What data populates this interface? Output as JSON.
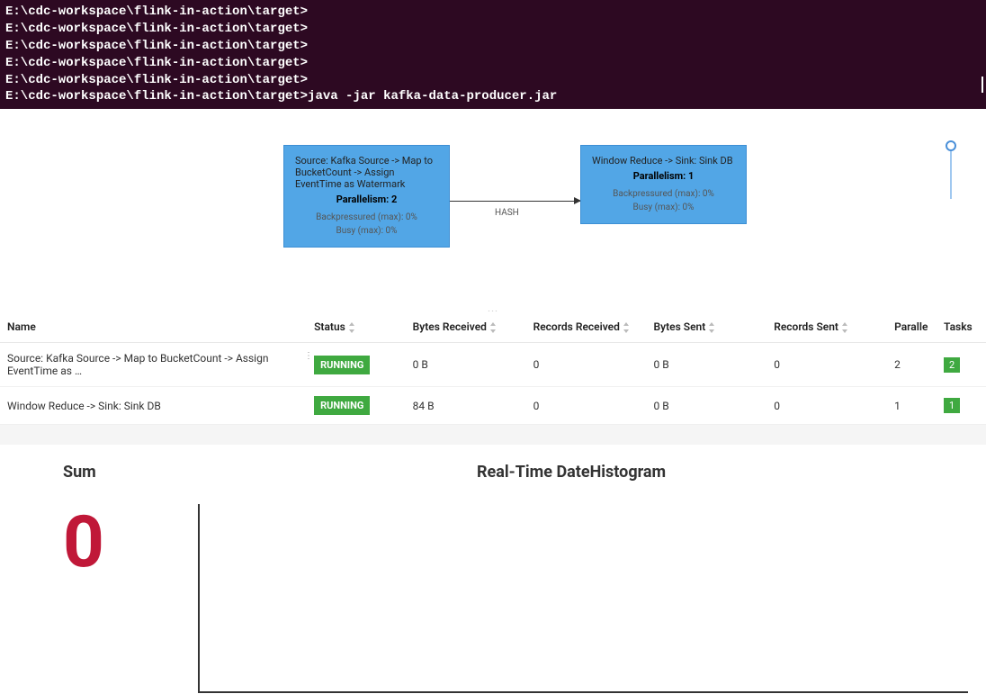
{
  "terminal": {
    "lines": [
      "E:\\cdc-workspace\\flink-in-action\\target>",
      "E:\\cdc-workspace\\flink-in-action\\target>",
      "E:\\cdc-workspace\\flink-in-action\\target>",
      "E:\\cdc-workspace\\flink-in-action\\target>",
      "E:\\cdc-workspace\\flink-in-action\\target>",
      "E:\\cdc-workspace\\flink-in-action\\target>java -jar kafka-data-producer.jar"
    ]
  },
  "graph": {
    "node1": {
      "title": "Source: Kafka Source -> Map to BucketCount -> Assign EventTime as Watermark",
      "parallelism": "Parallelism: 2",
      "backpressure": "Backpressured (max): 0%",
      "busy": "Busy (max): 0%"
    },
    "node2": {
      "title": "Window Reduce -> Sink: Sink DB",
      "parallelism": "Parallelism: 1",
      "backpressure": "Backpressured (max): 0%",
      "busy": "Busy (max): 0%"
    },
    "edge_label": "HASH"
  },
  "table": {
    "headers": {
      "name": "Name",
      "status": "Status",
      "bytes_received": "Bytes Received",
      "records_received": "Records Received",
      "bytes_sent": "Bytes Sent",
      "records_sent": "Records Sent",
      "parallelism": "Paralle",
      "tasks": "Tasks"
    },
    "rows": [
      {
        "name": "Source: Kafka Source -> Map to BucketCount -> Assign EventTime as …",
        "status": "RUNNING",
        "bytes_received": "0 B",
        "records_received": "0",
        "bytes_sent": "0 B",
        "records_sent": "0",
        "parallelism": "2",
        "tasks": "2"
      },
      {
        "name": "Window Reduce -> Sink: Sink DB",
        "status": "RUNNING",
        "bytes_received": "84 B",
        "records_received": "0",
        "bytes_sent": "0 B",
        "records_sent": "0",
        "parallelism": "1",
        "tasks": "1"
      }
    ]
  },
  "dashboard": {
    "sum_label": "Sum",
    "sum_value": "0",
    "histogram_label": "Real-Time DateHistogram"
  },
  "chart_data": {
    "type": "bar",
    "categories": [],
    "values": [],
    "title": "Real-Time DateHistogram",
    "xlabel": "",
    "ylabel": ""
  }
}
